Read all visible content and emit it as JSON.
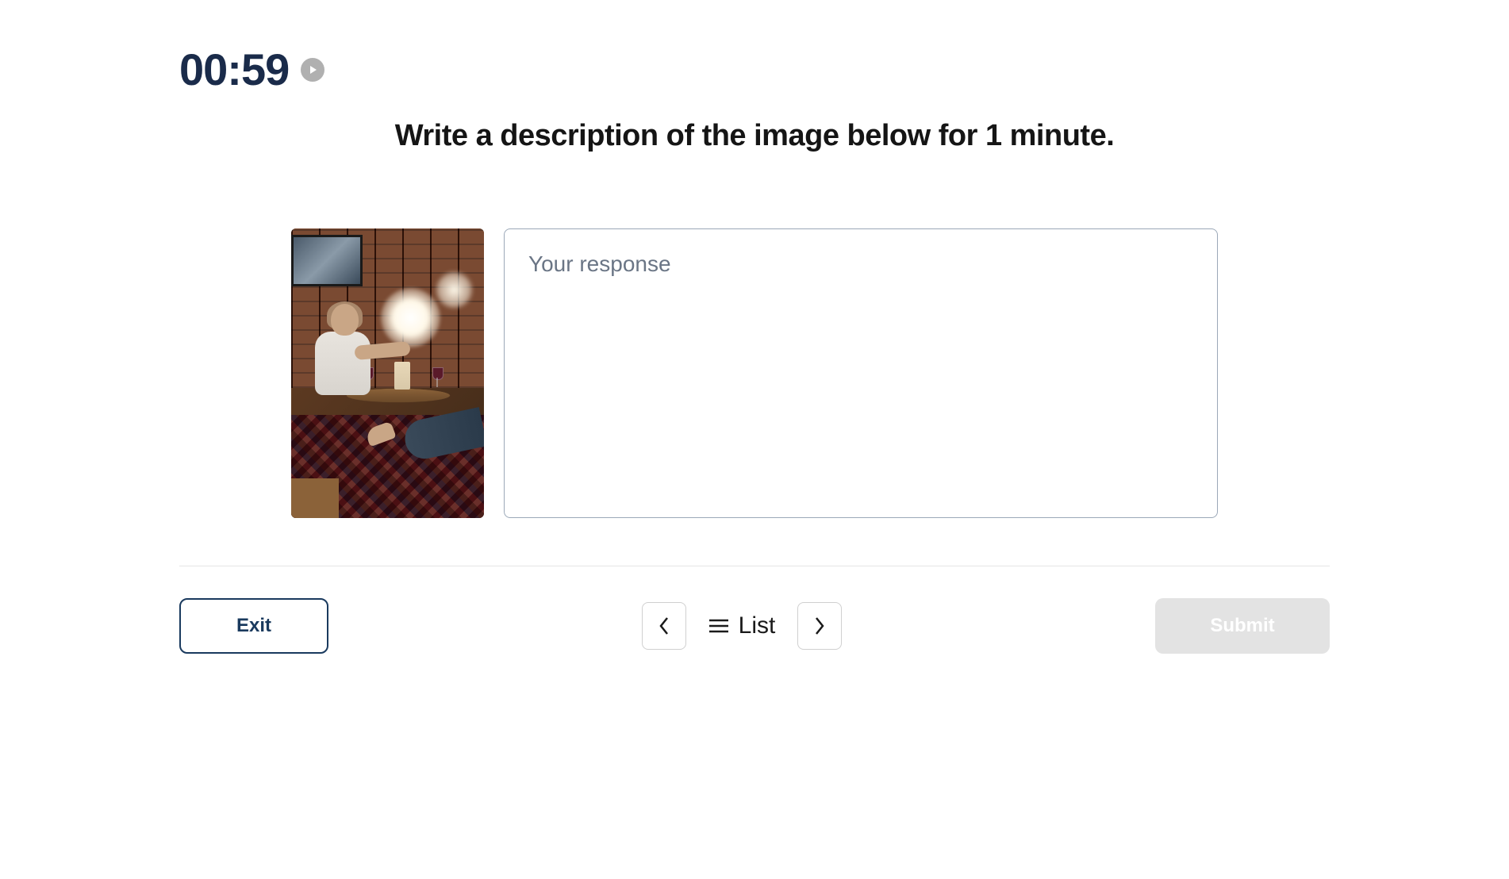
{
  "timer": {
    "value": "00:59"
  },
  "prompt": {
    "title": "Write a description of the image below for 1 minute."
  },
  "response": {
    "placeholder": "Your response",
    "value": ""
  },
  "footer": {
    "exit_label": "Exit",
    "list_label": "List",
    "submit_label": "Submit"
  }
}
